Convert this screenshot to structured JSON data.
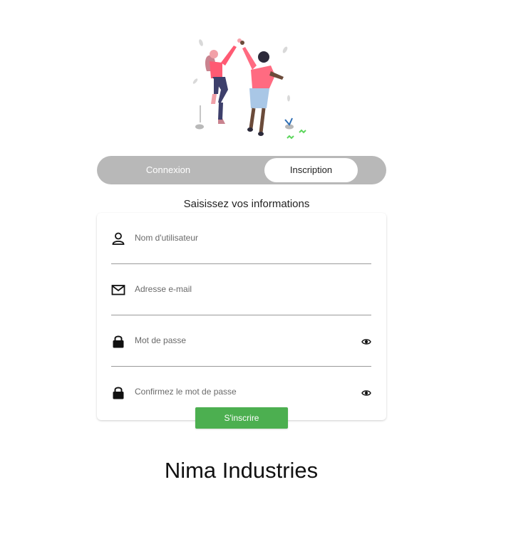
{
  "auth": {
    "tabs": [
      {
        "label": "Connexion",
        "active": false
      },
      {
        "label": "Inscription",
        "active": true
      }
    ],
    "subtitle": "Saisissez vos informations",
    "fields": [
      {
        "placeholder": "Nom d'utilisateur",
        "icon": "user-icon"
      },
      {
        "placeholder": "Adresse e-mail",
        "icon": "mail-icon"
      },
      {
        "placeholder": "Mot de passe",
        "icon": "lock-icon",
        "toggle_icon": "eye-icon"
      },
      {
        "placeholder": "Confirmez le mot de passe",
        "icon": "lock-icon",
        "toggle_icon": "eye-icon"
      }
    ],
    "submit_label": "S'inscrire"
  },
  "brand": {
    "name": "Nima Industries"
  },
  "colors": {
    "toggle_bg": "#b8b8b8",
    "accent_green": "#4caf50",
    "figure_pink": "#ff6b81"
  }
}
